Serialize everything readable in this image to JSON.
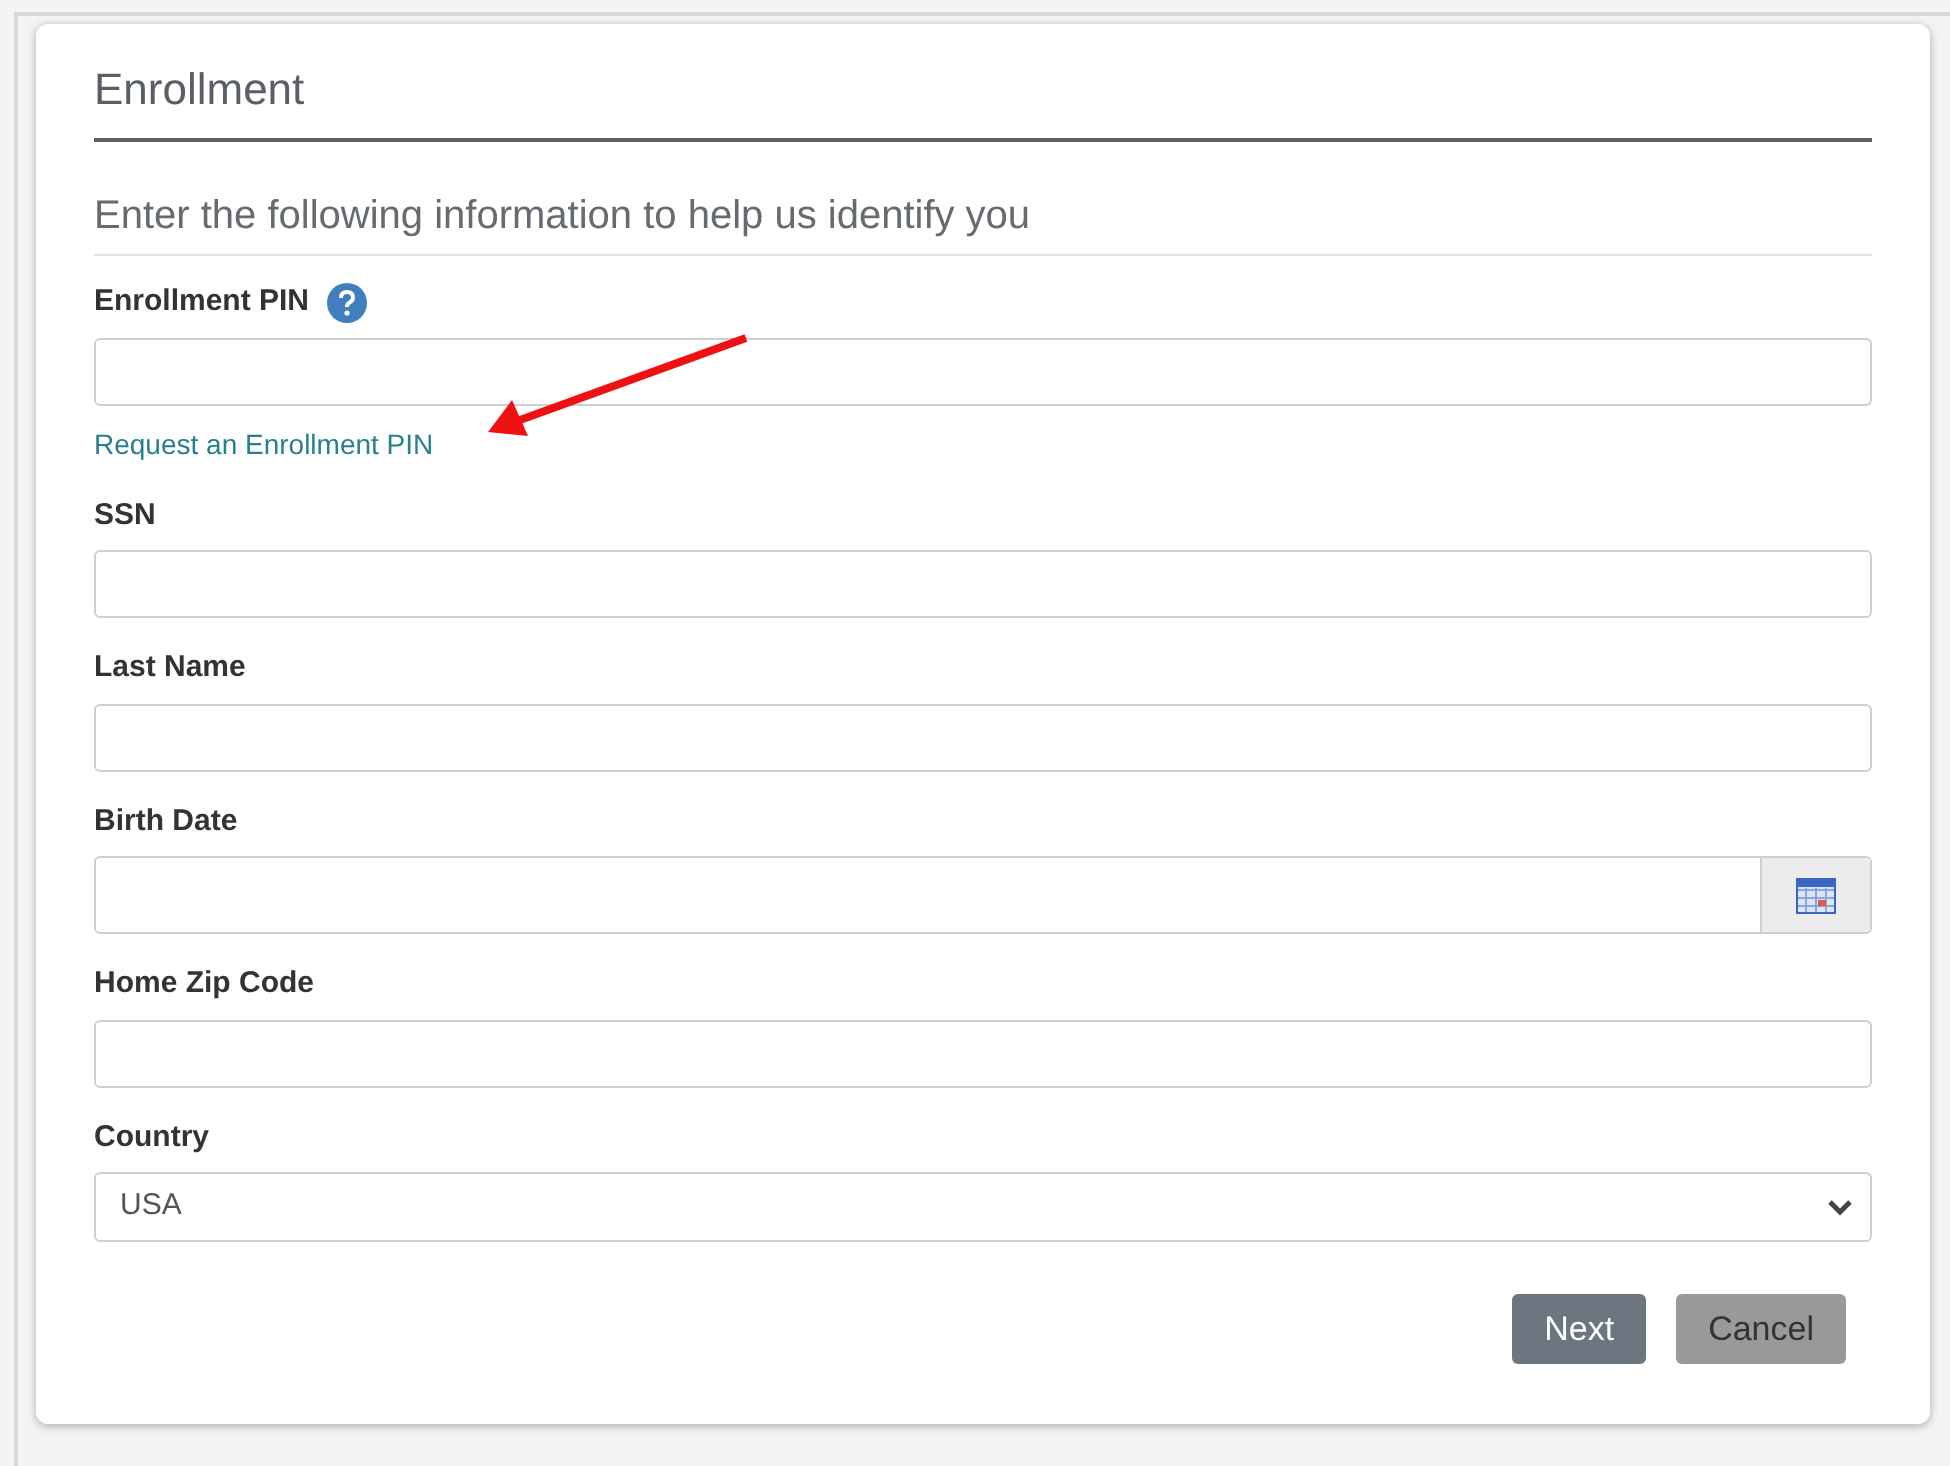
{
  "title": "Enrollment",
  "subtitle": "Enter the following information to help us identify you",
  "fields": [
    {
      "kind": "text",
      "label": "Enrollment PIN",
      "help": true,
      "link": "Request an Enrollment PIN"
    },
    {
      "kind": "text",
      "label": "SSN",
      "help": false
    },
    {
      "kind": "text",
      "label": "Last Name",
      "help": false
    },
    {
      "kind": "date",
      "label": "Birth Date",
      "help": false
    },
    {
      "kind": "text",
      "label": "Home Zip Code",
      "help": false
    },
    {
      "kind": "select",
      "label": "Country",
      "help": false,
      "value": "USA"
    }
  ],
  "buttons": [
    {
      "label": "Next",
      "kind": "primary"
    },
    {
      "label": "Cancel",
      "kind": "secondary"
    }
  ]
}
